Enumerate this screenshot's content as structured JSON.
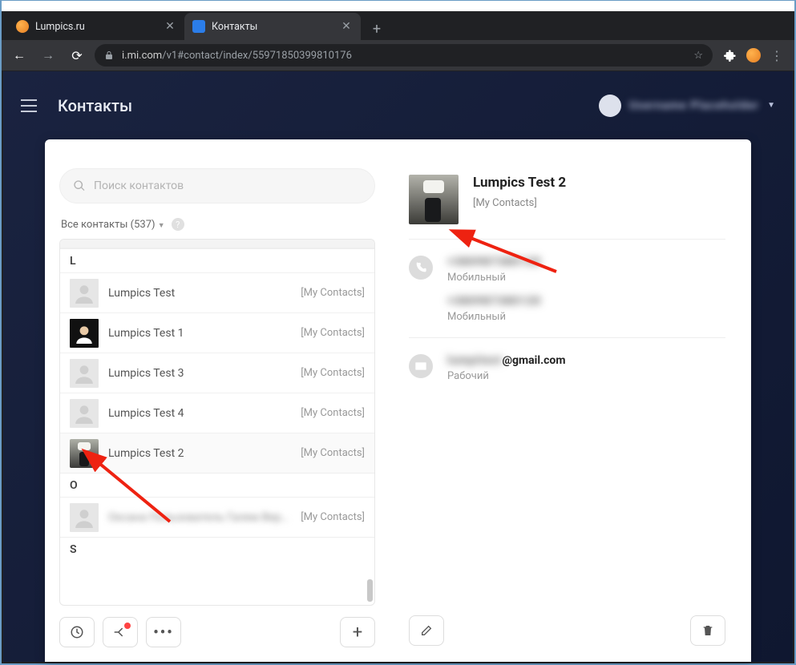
{
  "browser": {
    "tabs": [
      {
        "title": "Lumpics.ru"
      },
      {
        "title": "Контакты"
      }
    ],
    "url_host": "i.mi.com",
    "url_path": "/v1#contact/index/55971850399810176"
  },
  "app": {
    "header_title": "Контакты",
    "username_placeholder": "Username Placeholder"
  },
  "search": {
    "placeholder": "Поиск контактов"
  },
  "filter": {
    "label": "Все контакты (537)"
  },
  "sections": {
    "L": "L",
    "O": "O",
    "S": "S"
  },
  "contacts": [
    {
      "name": "Lumpics Test",
      "group": "[My Contacts]",
      "avatar": "blank"
    },
    {
      "name": "Lumpics Test 1",
      "group": "[My Contacts]",
      "avatar": "dark"
    },
    {
      "name": "Lumpics Test 3",
      "group": "[My Contacts]",
      "avatar": "blank"
    },
    {
      "name": "Lumpics Test 4",
      "group": "[My Contacts]",
      "avatar": "blank"
    },
    {
      "name": "Lumpics Test 2",
      "group": "[My Contacts]",
      "avatar": "photo"
    }
  ],
  "contact_o": {
    "name": "Оксана Пользователь Галем Верш...",
    "group": "[My Contacts]"
  },
  "detail": {
    "name": "Lumpics Test 2",
    "group": "[My Contacts]",
    "phone1": {
      "masked": "+380987380120",
      "label": "Мобильный"
    },
    "phone2": {
      "masked": "+380987380120",
      "label": "Мобильный"
    },
    "email": {
      "masked": "lumpitest",
      "suffix": "@gmail.com",
      "label": "Рабочий"
    }
  }
}
